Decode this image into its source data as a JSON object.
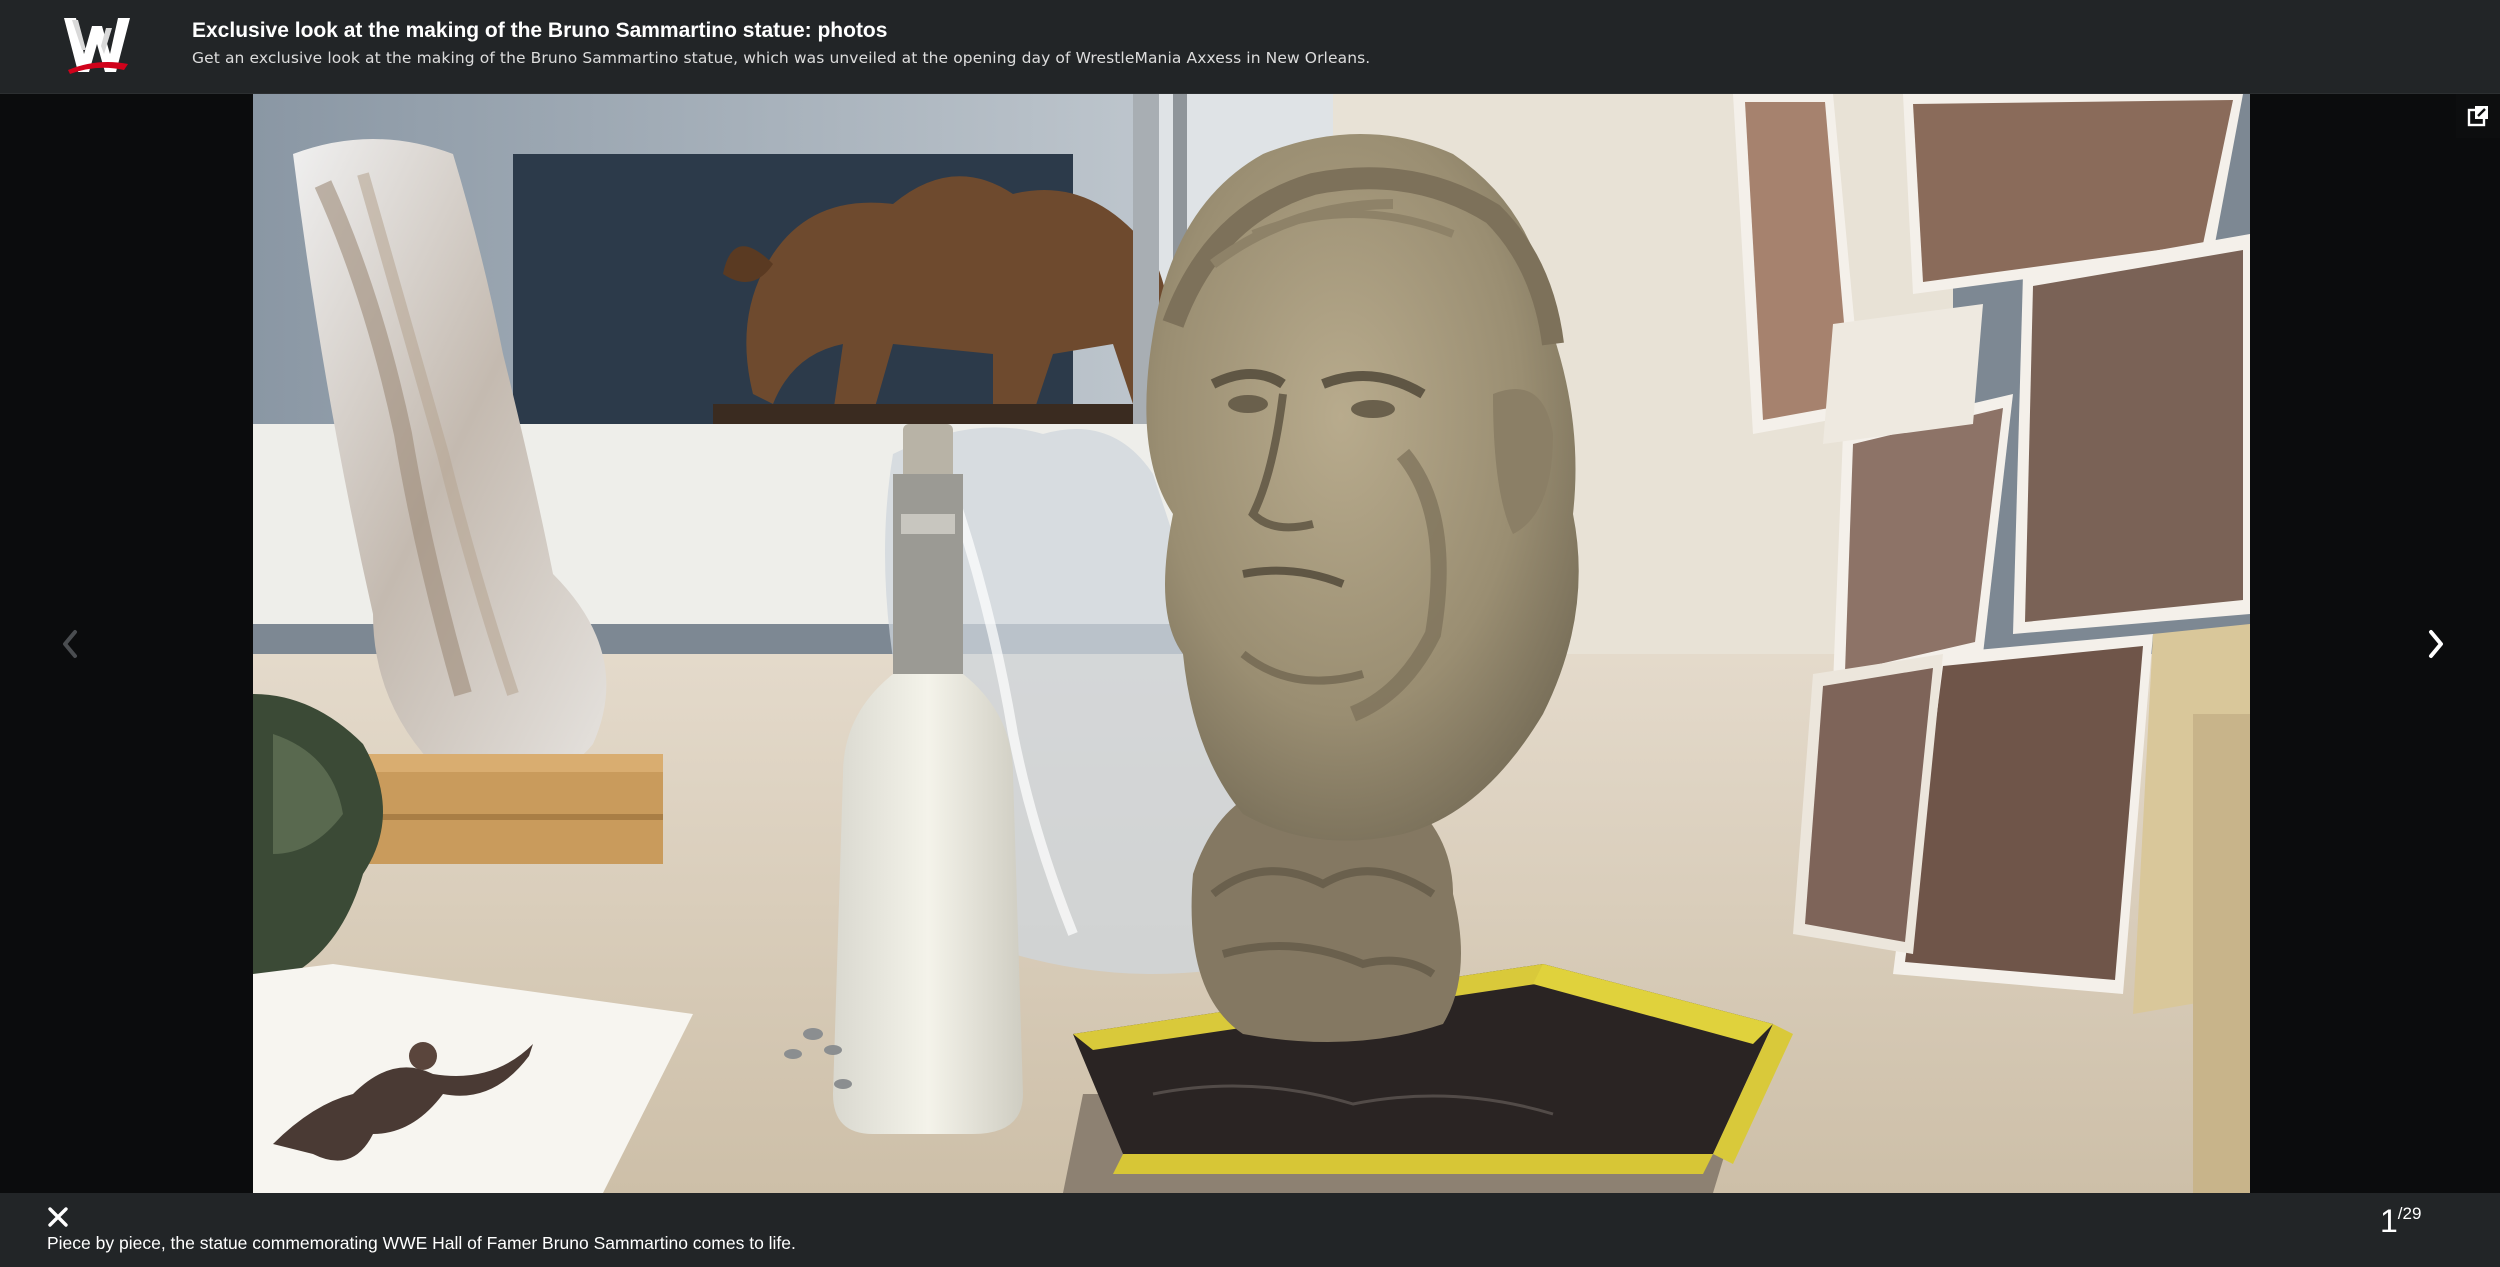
{
  "header": {
    "logo": "wwe-logo",
    "title": "Exclusive look at the making of the Bruno Sammartino statue: photos",
    "subtitle": "Get an exclusive look at the making of the Bruno Sammartino statue, which was unveiled at the opening day of WrestleMania Axxess in New Orleans."
  },
  "viewer": {
    "prev_icon": "chevron-left-icon",
    "next_icon": "chevron-right-icon",
    "fullscreen_icon": "open-external-icon",
    "close_icon": "close-icon",
    "caption": "Piece by piece, the statue commemorating WWE Hall of Famer Bruno Sammartino comes to life.",
    "current": "1",
    "total": "/29"
  },
  "colors": {
    "bar_background": "#222527",
    "stage_background": "#0b0c0d",
    "logo_red": "#d0021b"
  }
}
